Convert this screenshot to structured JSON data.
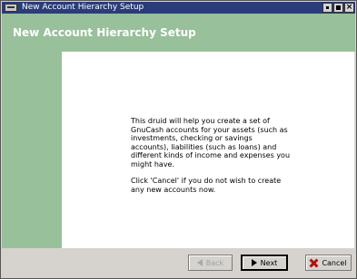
{
  "window": {
    "title": "New Account Hierarchy Setup",
    "icon": "app-icon",
    "controls": [
      "minimize-icon",
      "maximize-icon",
      "close-icon"
    ]
  },
  "header": {
    "title": "New Account Hierarchy Setup",
    "color": "#98c09a"
  },
  "content": {
    "paragraph1": "This druid will help you create a set of GnuCash accounts for your assets (such as investments, checking or savings accounts), liabilities (such as loans) and different kinds of income and expenses you might have.",
    "paragraph2": "Click 'Cancel'  if you do not wish to create any new accounts now."
  },
  "buttons": {
    "back": {
      "label": "Back",
      "enabled": false,
      "icon": "arrow-left-icon"
    },
    "next": {
      "label": "Next",
      "enabled": true,
      "icon": "arrow-right-icon"
    },
    "cancel": {
      "label": "Cancel",
      "enabled": true,
      "icon": "cancel-x-icon"
    }
  }
}
